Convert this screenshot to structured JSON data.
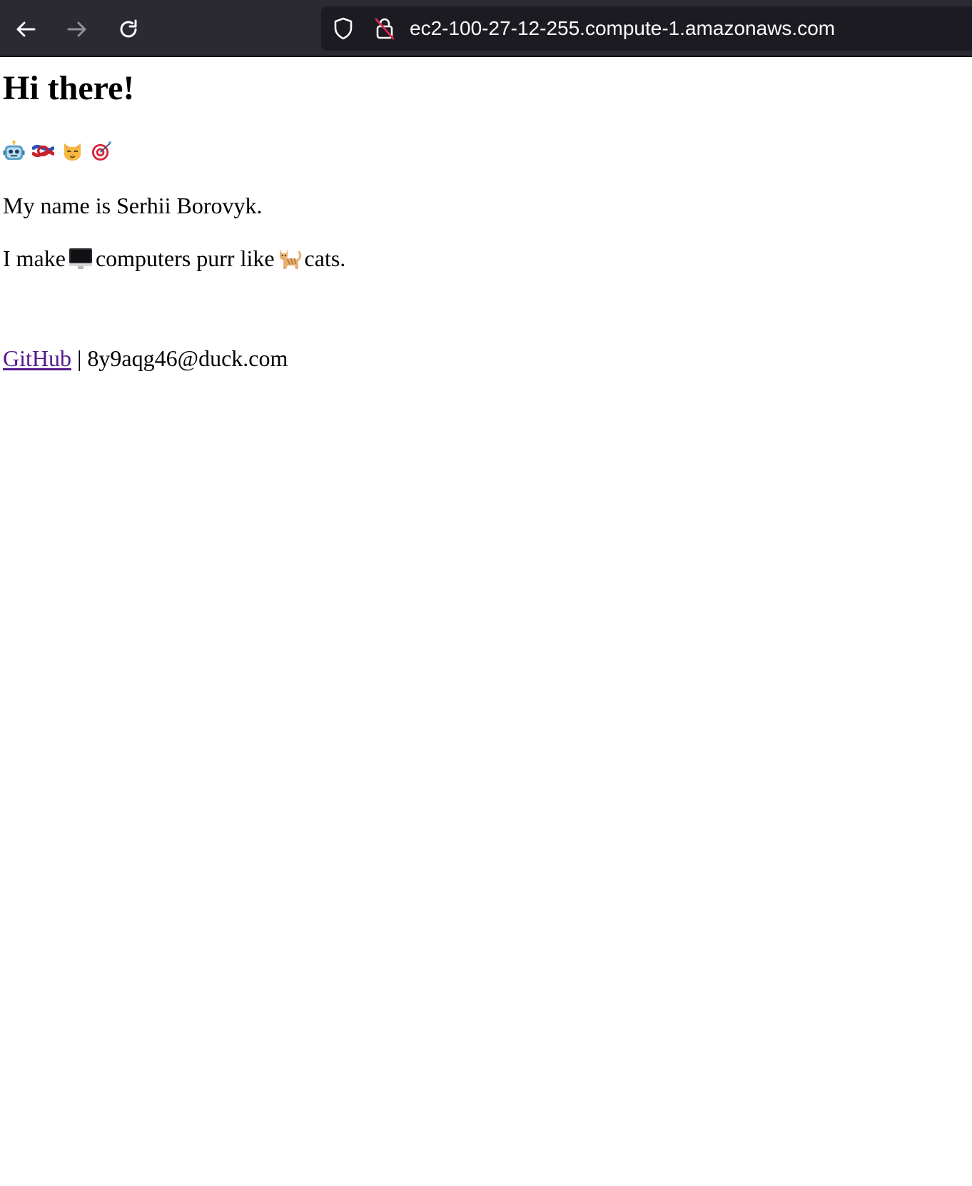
{
  "browser": {
    "url": "ec2-100-27-12-255.compute-1.amazonaws.com",
    "icons": {
      "back": "back-arrow-icon",
      "forward": "forward-arrow-icon",
      "reload": "reload-icon",
      "shield": "tracking-protection-shield-icon",
      "lock": "insecure-connection-lock-icon"
    }
  },
  "page": {
    "heading": "Hi there!",
    "emojis": [
      "robot-emoji",
      "knot-emoji",
      "cat-face-emoji",
      "direct-hit-emoji"
    ],
    "intro": "My name is Serhii Borovyk.",
    "tagline": {
      "part1": "I make",
      "part2": "computers purr like",
      "part3": "cats."
    },
    "footer": {
      "github_label": "GitHub",
      "separator": "|",
      "email": "8y9aqg46@duck.com"
    }
  },
  "colors": {
    "toolbar_bg": "#2b2a33",
    "urlbar_bg": "#1c1b22",
    "visited_link": "#551a8b"
  }
}
